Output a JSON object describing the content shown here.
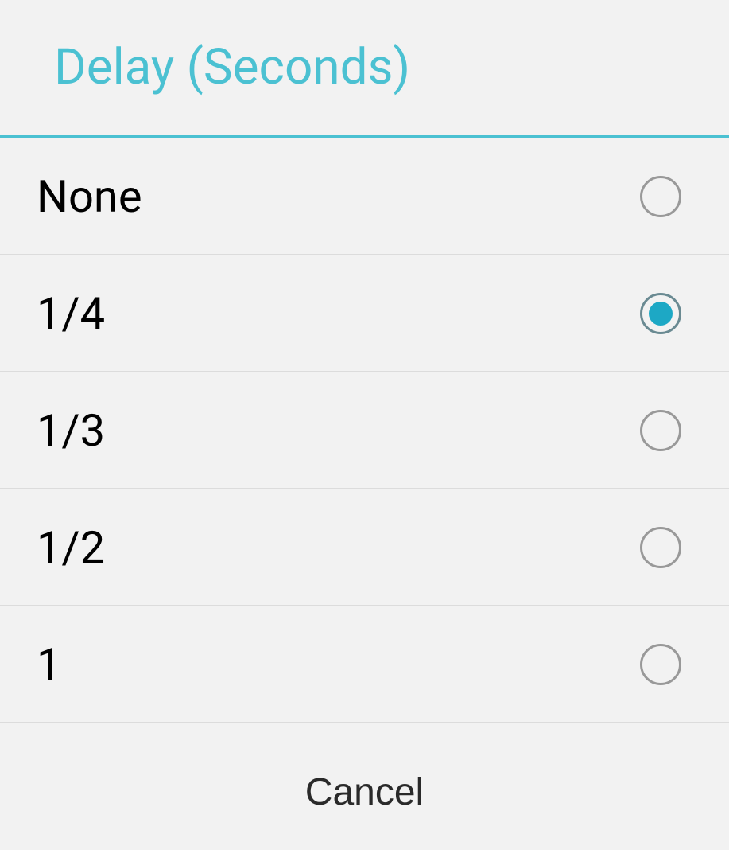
{
  "dialog": {
    "title": "Delay (Seconds)",
    "options": [
      {
        "label": "None",
        "selected": false
      },
      {
        "label": "1/4",
        "selected": true
      },
      {
        "label": "1/3",
        "selected": false
      },
      {
        "label": "1/2",
        "selected": false
      },
      {
        "label": "1",
        "selected": false
      }
    ],
    "cancel_label": "Cancel"
  }
}
